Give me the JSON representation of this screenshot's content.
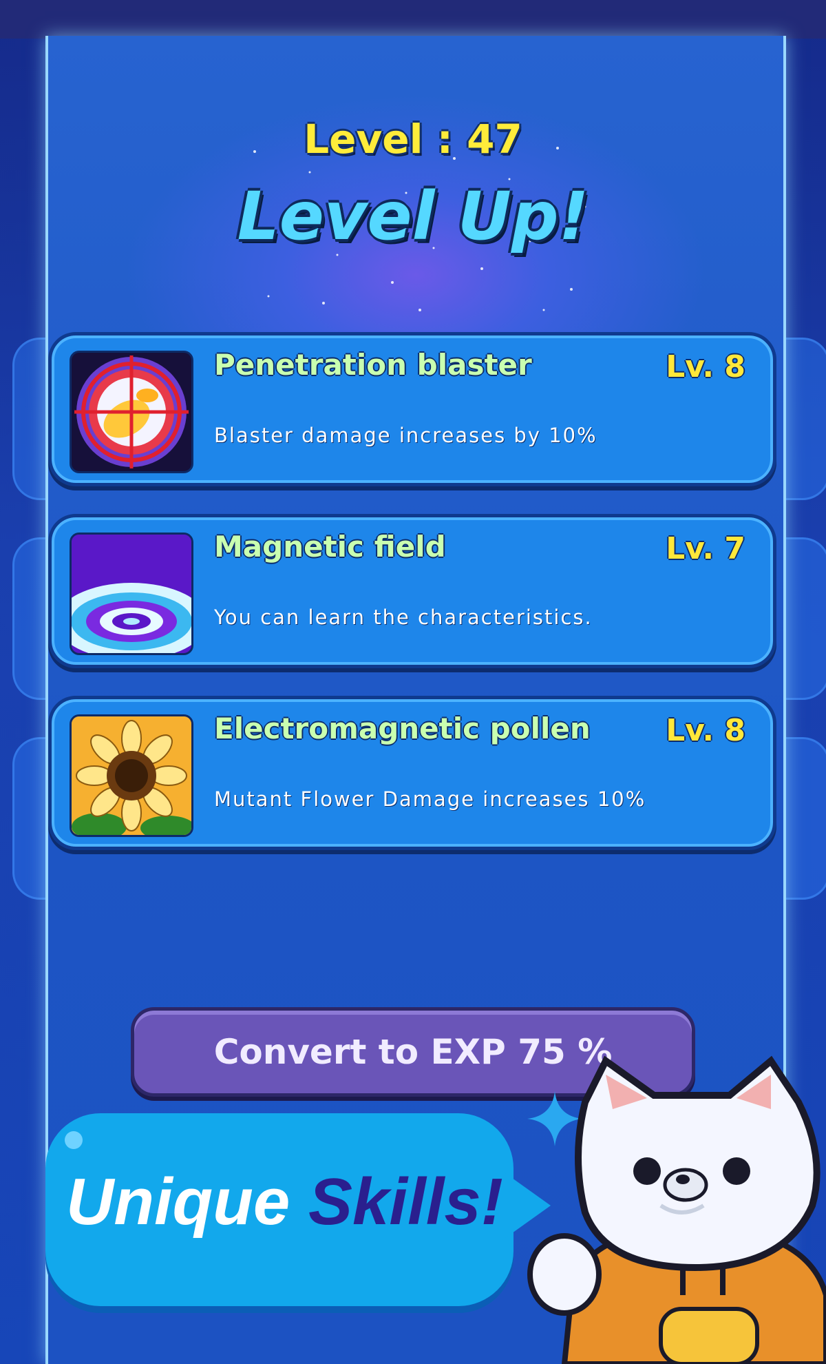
{
  "header": {
    "level_text": "Level : 47",
    "title": "Level Up!"
  },
  "skills": [
    {
      "name": "Penetration blaster",
      "level": "Lv. 8",
      "description": "Blaster damage increases by 10%",
      "icon": "crosshair-rocket-icon"
    },
    {
      "name": "Magnetic field",
      "level": "Lv. 7",
      "description": "You can learn the characteristics.",
      "icon": "magnetic-rings-icon"
    },
    {
      "name": "Electromagnetic pollen",
      "level": "Lv. 8",
      "description": "Mutant Flower Damage increases 10%",
      "icon": "sunflower-icon"
    }
  ],
  "convert_button": {
    "label": "Convert to EXP 75 %"
  },
  "promo": {
    "word1": "Unique",
    "word2": "Skills!"
  },
  "colors": {
    "accent_yellow": "#ffec3a",
    "title_cyan": "#55d8ff",
    "card_blue": "#1e86ea",
    "button_purple": "#6a55b8"
  }
}
